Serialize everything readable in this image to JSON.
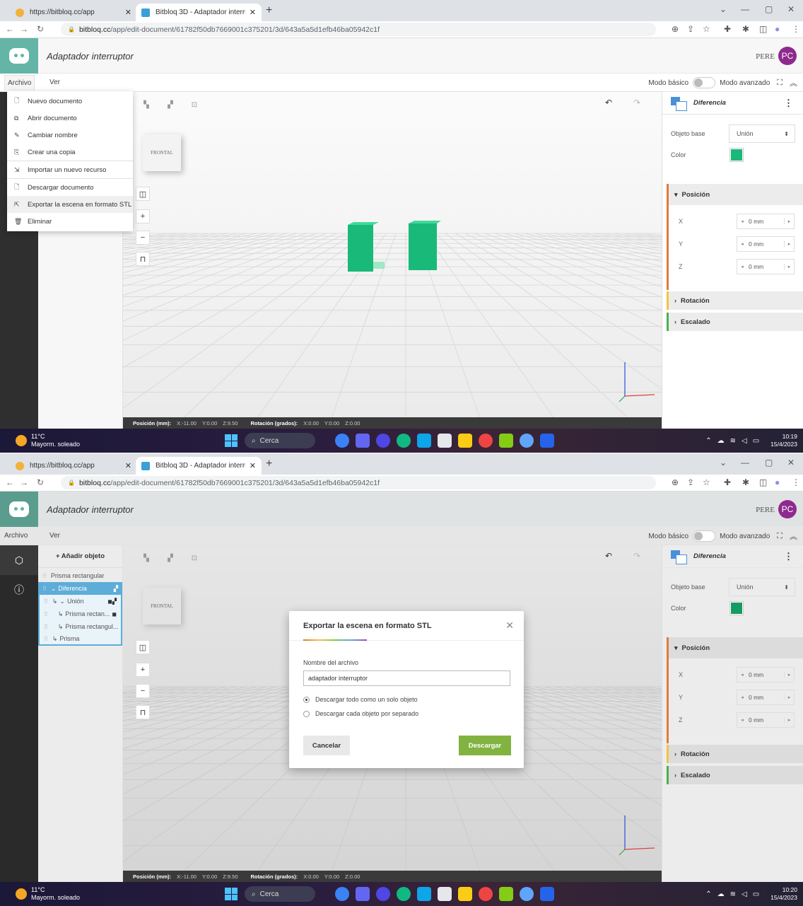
{
  "browser": {
    "tab1_title": "https://bitbloq.cc/app",
    "tab2_title": "Bitbloq 3D - Adaptador interrupt",
    "url_host": "bitbloq.cc",
    "url_path": "/app/edit-document/61782f50db7669001c375201/3d/643a5a5d1efb46ba05942c1f"
  },
  "app": {
    "doc_title": "Adaptador interruptor",
    "user": "PERE",
    "avatar": "PC",
    "menu_archivo": "Archivo",
    "menu_ver": "Ver",
    "modo_basico": "Modo básico",
    "modo_avanzado": "Modo avanzado",
    "add_object": "+ Añadir objeto"
  },
  "file_menu": [
    {
      "label": "Nuevo documento",
      "icon": "new-doc-icon"
    },
    {
      "label": "Abrir documento",
      "icon": "open-doc-icon"
    },
    {
      "label": "Cambiar nombre",
      "icon": "pencil-icon"
    },
    {
      "label": "Crear una copia",
      "icon": "copy-icon"
    },
    {
      "label": "Importar un nuevo recurso",
      "icon": "import-icon"
    },
    {
      "label": "Descargar documento",
      "icon": "download-icon"
    },
    {
      "label": "Exportar la escena en formato STL",
      "icon": "export-icon"
    },
    {
      "label": "Eliminar",
      "icon": "trash-icon"
    }
  ],
  "tree": [
    {
      "label": "Prisma rectangular"
    },
    {
      "label": "Diferencia"
    },
    {
      "label": "Unión"
    },
    {
      "label": "Prisma rectan..."
    },
    {
      "label": "Prisma rectangul..."
    },
    {
      "label": "Prisma"
    }
  ],
  "viewport": {
    "cube_label": "FRONTAL",
    "status_pos_label": "Posición (mm):",
    "pos_x": "X:-11.00",
    "pos_y": "Y:0.00",
    "pos_z": "Z:9.50",
    "status_rot_label": "Rotación (grados):",
    "rot_x": "X:0.00",
    "rot_y": "Y:0.00",
    "rot_z": "Z:0.00"
  },
  "props": {
    "operation": "Diferencia",
    "base_label": "Objeto base",
    "base_value": "Unión",
    "color_label": "Color",
    "color": "#19b97a",
    "posicion": "Posición",
    "x_label": "X",
    "y_label": "Y",
    "z_label": "Z",
    "x_value": "0 mm",
    "y_value": "0 mm",
    "z_value": "0 mm",
    "rotacion": "Rotación",
    "escalado": "Escalado"
  },
  "dialog": {
    "title": "Exportar la escena en formato STL",
    "filename_label": "Nombre del archivo",
    "filename_value": "adaptador interruptor",
    "option1": "Descargar todo como un solo objeto",
    "option2": "Descargar cada objeto por separado",
    "cancel": "Cancelar",
    "download": "Descargar"
  },
  "taskbar": {
    "temp": "11°C",
    "weather": "Mayorm. soleado",
    "search": "Cerca",
    "time1": "10:19",
    "time2": "10:20",
    "date": "15/4/2023"
  }
}
